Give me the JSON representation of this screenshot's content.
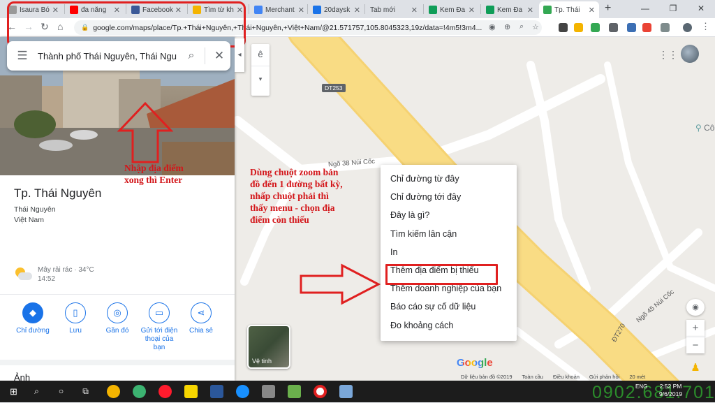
{
  "browser": {
    "tabs": [
      {
        "label": "Isaura Bó",
        "color": "#999999"
      },
      {
        "label": "đa năng",
        "color": "#ff0000"
      },
      {
        "label": "Facebook",
        "color": "#3b5998"
      },
      {
        "label": "Tìm từ kh",
        "color": "#f4b400"
      },
      {
        "label": "Merchant",
        "color": "#4285f4"
      },
      {
        "label": "20daysk",
        "color": "#1a73e8"
      },
      {
        "label": "Tab mới",
        "color": "#cccccc"
      },
      {
        "label": "Kem Đa",
        "color": "#0f9d58"
      },
      {
        "label": "Kem Đa",
        "color": "#0f9d58"
      },
      {
        "label": "Tp. Thái",
        "color": "#34a853"
      }
    ],
    "url": "google.com/maps/place/Tp.+Thái+Nguyên,+Thái+Nguyên,+Việt+Nam/@21.571757,105.8045323,19z/data=!4m5!3m4..."
  },
  "search": {
    "value": "Thành phố Thái Nguyên, Thái Ngu"
  },
  "place": {
    "name": "Tp. Thái Nguyên",
    "region": "Thái Nguyên",
    "country": "Việt Nam",
    "weather": "Mây rải rác · 34°C",
    "weather_time": "14:52"
  },
  "actions": [
    {
      "label": "Chỉ đường",
      "icon": "directions-icon"
    },
    {
      "label": "Lưu",
      "icon": "bookmark-icon"
    },
    {
      "label": "Gần đó",
      "icon": "nearby-icon"
    },
    {
      "label": "Gửi tới điện thoại của bạn",
      "icon": "send-to-phone-icon"
    },
    {
      "label": "Chia sẻ",
      "icon": "share-icon"
    }
  ],
  "photos_header": "Ảnh",
  "layer_label": "ê",
  "context_menu": [
    "Chỉ đường từ đây",
    "Chỉ đường tới đây",
    "Đây là gì?",
    "Tìm kiếm lân cận",
    "In",
    "Thêm địa điểm bị thiếu",
    "Thêm doanh nghiệp của bạn",
    "Báo cáo sự cố dữ liệu",
    "Đo khoảng cách"
  ],
  "annotations": {
    "left_line1": "Nhập địa điểm",
    "left_line2": "xong thì Enter",
    "right": "Dùng chuột zoom bản đồ đến 1 đường bất kỳ, nhấp chuột phải thì thấy menu - chọn địa điểm còn thiếu"
  },
  "map_labels": {
    "road1": "Ngõ 38 Núi Cốc",
    "road2": "Ngõ 45 Núi Cốc",
    "road3": "ĐT270",
    "badge": "DT253",
    "poi": "Cô"
  },
  "satellite_label": "Vệ tinh",
  "google_logo": "Google",
  "footer": [
    "Dữ liệu bản đồ ©2019",
    "Toàn cầu",
    "Điều khoản",
    "Gửi phản hồi",
    "20 mét"
  ],
  "taskbar": {
    "lang": "ENG",
    "time": "2:52 PM",
    "date": "9/6/2019"
  },
  "watermark": "0902.681.701",
  "colors": {
    "accent": "#1a73e8",
    "annotation_red": "#d3161a",
    "road_yellow": "#f9dc84"
  }
}
